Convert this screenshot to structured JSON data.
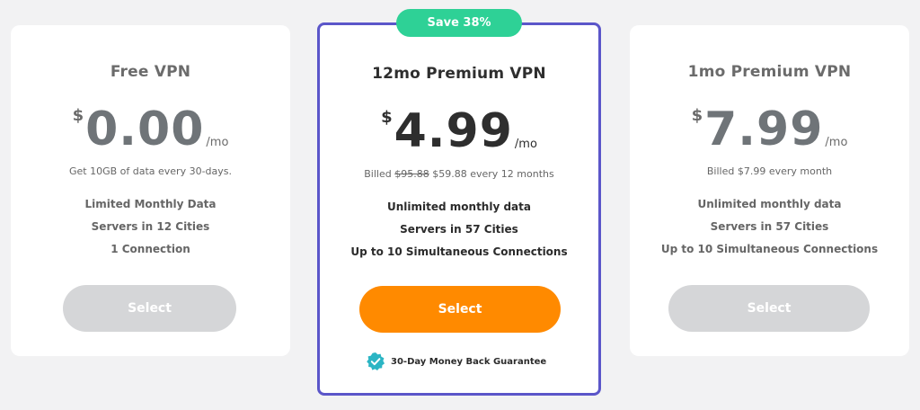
{
  "plans": [
    {
      "name": "Free VPN",
      "currency": "$",
      "amount": "0.00",
      "period": "/mo",
      "billing": "Get 10GB of data every 30-days.",
      "features": [
        "Limited Monthly Data",
        "Servers in 12 Cities",
        "1 Connection"
      ],
      "button_label": "Select"
    },
    {
      "badge": "Save 38%",
      "name": "12mo Premium VPN",
      "currency": "$",
      "amount": "4.99",
      "period": "/mo",
      "billing_prefix": "Billed ",
      "billing_old": "$95.88",
      "billing_suffix": " $59.88 every 12 months",
      "features": [
        "Unlimited monthly data",
        "Servers in 57 Cities",
        "Up to 10 Simultaneous Connections"
      ],
      "button_label": "Select",
      "guarantee": "30-Day Money Back Guarantee"
    },
    {
      "name": "1mo Premium VPN",
      "currency": "$",
      "amount": "7.99",
      "period": "/mo",
      "billing": "Billed $7.99 every month",
      "features": [
        "Unlimited monthly data",
        "Servers in 57 Cities",
        "Up to 10 Simultaneous Connections"
      ],
      "button_label": "Select"
    }
  ],
  "colors": {
    "accent_border": "#5b56c9",
    "badge": "#2ed196",
    "primary_button": "#ff8a00",
    "disabled_button": "#d5d6d8",
    "check_badge": "#2bb5c4"
  }
}
